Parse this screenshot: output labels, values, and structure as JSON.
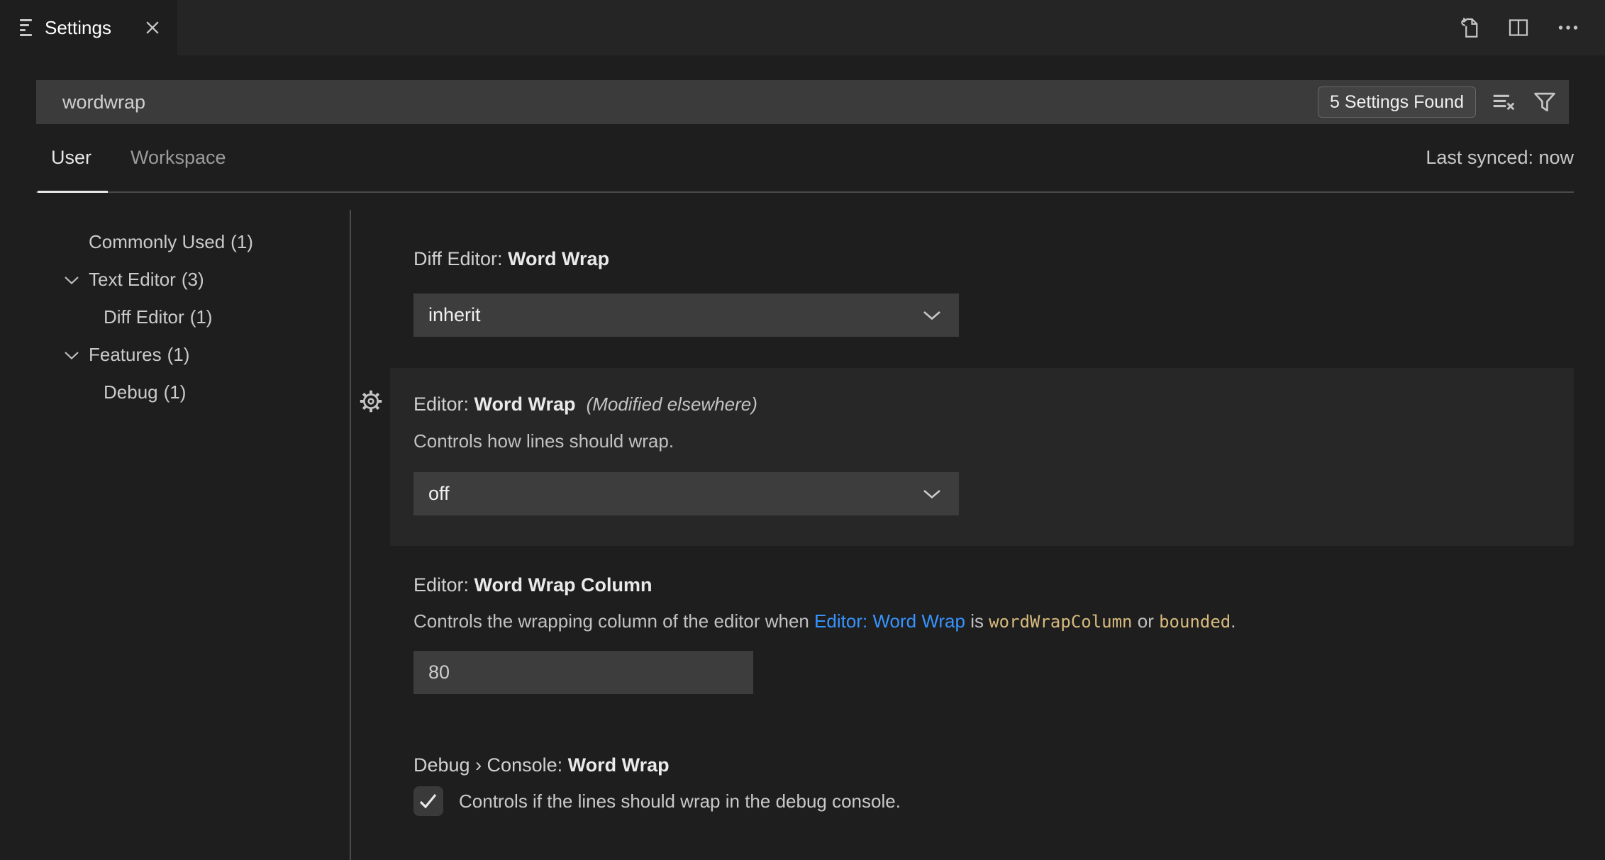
{
  "tab": {
    "title": "Settings"
  },
  "search": {
    "value": "wordwrap",
    "results_badge": "5 Settings Found"
  },
  "scope": {
    "user": "User",
    "workspace": "Workspace",
    "last_synced": "Last synced: now"
  },
  "toc": {
    "items": [
      {
        "label": "Commonly Used",
        "count": "(1)",
        "level": 1,
        "chevron": false
      },
      {
        "label": "Text Editor",
        "count": "(3)",
        "level": 1,
        "chevron": true
      },
      {
        "label": "Diff Editor",
        "count": "(1)",
        "level": 2,
        "chevron": false
      },
      {
        "label": "Features",
        "count": "(1)",
        "level": 1,
        "chevron": true
      },
      {
        "label": "Debug",
        "count": "(1)",
        "level": 2,
        "chevron": false
      }
    ]
  },
  "settings": [
    {
      "category": "Diff Editor: ",
      "name": "Word Wrap",
      "control": "dropdown",
      "value": "inherit"
    },
    {
      "category": "Editor: ",
      "name": "Word Wrap",
      "suffix": "(Modified elsewhere)",
      "description": "Controls how lines should wrap.",
      "control": "dropdown",
      "value": "off",
      "highlighted": true
    },
    {
      "category": "Editor: ",
      "name": "Word Wrap Column",
      "description_parts": {
        "pre": "Controls the wrapping column of the editor when ",
        "link": "Editor: Word Wrap",
        "mid": " is ",
        "code1": "wordWrapColumn",
        "or": " or ",
        "code2": "bounded",
        "post": "."
      },
      "control": "input",
      "value": "80"
    },
    {
      "category": "Debug › Console: ",
      "name": "Word Wrap",
      "control": "checkbox",
      "checked": true,
      "description": "Controls if the lines should wrap in the debug console."
    }
  ],
  "icons": {
    "tab_icon": "settings-list-icon",
    "close": "close-icon",
    "open_json": "open-settings-json-icon",
    "split": "split-editor-icon",
    "more": "more-actions-icon",
    "clear": "clear-search-results-icon",
    "filter": "filter-icon",
    "gear": "gear-icon",
    "check": "checkmark-icon",
    "chevron": "chevron-down-icon"
  },
  "colors": {
    "page_bg": "#1e1e1e",
    "tabbar_bg": "#252526",
    "input_bg": "#3d3d3e",
    "row_highlight": "#272728",
    "link": "#3794ff",
    "code": "#d7ba7d",
    "active_underline": "#e7e7e7"
  }
}
